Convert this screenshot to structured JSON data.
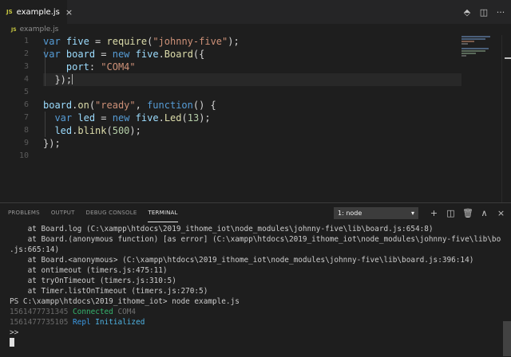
{
  "tab": {
    "icon": "JS",
    "filename": "example.js",
    "close": "×"
  },
  "breadcrumb": {
    "icon": "JS",
    "file": "example.js"
  },
  "editor_actions": [
    {
      "name": "open-changes-icon",
      "glyph": "⬘"
    },
    {
      "name": "split-editor-icon",
      "glyph": "◫"
    },
    {
      "name": "more-actions-icon",
      "glyph": "···"
    }
  ],
  "line_numbers": [
    "1",
    "2",
    "3",
    "4",
    "5",
    "6",
    "7",
    "8",
    "9",
    "10"
  ],
  "code_lines": [
    [
      {
        "c": "k",
        "t": "var"
      },
      {
        "c": "p",
        "t": " "
      },
      {
        "c": "v",
        "t": "five"
      },
      {
        "c": "p",
        "t": " = "
      },
      {
        "c": "f",
        "t": "require"
      },
      {
        "c": "p",
        "t": "("
      },
      {
        "c": "s",
        "t": "\"johnny-five\""
      },
      {
        "c": "p",
        "t": ");"
      }
    ],
    [
      {
        "c": "k",
        "t": "var"
      },
      {
        "c": "p",
        "t": " "
      },
      {
        "c": "v",
        "t": "board"
      },
      {
        "c": "p",
        "t": " = "
      },
      {
        "c": "k",
        "t": "new"
      },
      {
        "c": "p",
        "t": " "
      },
      {
        "c": "v",
        "t": "five"
      },
      {
        "c": "p",
        "t": "."
      },
      {
        "c": "f",
        "t": "Board"
      },
      {
        "c": "p",
        "t": "({"
      }
    ],
    [
      {
        "c": "p",
        "t": "    "
      },
      {
        "c": "v",
        "t": "port"
      },
      {
        "c": "p",
        "t": ": "
      },
      {
        "c": "s",
        "t": "\"COM4\""
      }
    ],
    [
      {
        "c": "p",
        "t": "  });"
      }
    ],
    [],
    [
      {
        "c": "v",
        "t": "board"
      },
      {
        "c": "p",
        "t": "."
      },
      {
        "c": "f",
        "t": "on"
      },
      {
        "c": "p",
        "t": "("
      },
      {
        "c": "s",
        "t": "\"ready\""
      },
      {
        "c": "p",
        "t": ", "
      },
      {
        "c": "k",
        "t": "function"
      },
      {
        "c": "p",
        "t": "() {"
      }
    ],
    [
      {
        "c": "p",
        "t": "  "
      },
      {
        "c": "k",
        "t": "var"
      },
      {
        "c": "p",
        "t": " "
      },
      {
        "c": "v",
        "t": "led"
      },
      {
        "c": "p",
        "t": " = "
      },
      {
        "c": "k",
        "t": "new"
      },
      {
        "c": "p",
        "t": " "
      },
      {
        "c": "v",
        "t": "five"
      },
      {
        "c": "p",
        "t": "."
      },
      {
        "c": "f",
        "t": "Led"
      },
      {
        "c": "p",
        "t": "("
      },
      {
        "c": "n",
        "t": "13"
      },
      {
        "c": "p",
        "t": ");"
      }
    ],
    [
      {
        "c": "p",
        "t": "  "
      },
      {
        "c": "v",
        "t": "led"
      },
      {
        "c": "p",
        "t": "."
      },
      {
        "c": "f",
        "t": "blink"
      },
      {
        "c": "p",
        "t": "("
      },
      {
        "c": "n",
        "t": "500"
      },
      {
        "c": "p",
        "t": ");"
      }
    ],
    [
      {
        "c": "p",
        "t": "});"
      }
    ],
    []
  ],
  "panel": {
    "tabs": [
      {
        "id": "problems",
        "label": "PROBLEMS",
        "active": false
      },
      {
        "id": "output",
        "label": "OUTPUT",
        "active": false
      },
      {
        "id": "debug-console",
        "label": "DEBUG CONSOLE",
        "active": false
      },
      {
        "id": "terminal",
        "label": "TERMINAL",
        "active": true
      }
    ],
    "terminal_select": "1: node",
    "terminal_select_caret": "▾",
    "actions": [
      {
        "name": "new-terminal-icon",
        "glyph": "+"
      },
      {
        "name": "split-terminal-icon",
        "glyph": "◫"
      },
      {
        "name": "kill-terminal-icon",
        "glyph": "🗑"
      },
      {
        "name": "maximize-panel-icon",
        "glyph": "∧"
      },
      {
        "name": "close-panel-icon",
        "glyph": "×"
      }
    ]
  },
  "terminal_lines": [
    [
      {
        "c": "",
        "t": "    at Board.log (C:\\xampp\\htdocs\\2019_ithome_iot\\node_modules\\johnny-five\\lib\\board.js:654:8)"
      }
    ],
    [
      {
        "c": "",
        "t": "    at Board.(anonymous function) [as error] (C:\\xampp\\htdocs\\2019_ithome_iot\\node_modules\\johnny-five\\lib\\board"
      }
    ],
    [
      {
        "c": "",
        "t": ".js:665:14)"
      }
    ],
    [
      {
        "c": "",
        "t": "    at Board.<anonymous> (C:\\xampp\\htdocs\\2019_ithome_iot\\node_modules\\johnny-five\\lib\\board.js:396:14)"
      }
    ],
    [
      {
        "c": "",
        "t": "    at ontimeout (timers.js:475:11)"
      }
    ],
    [
      {
        "c": "",
        "t": "    at tryOnTimeout (timers.js:310:5)"
      }
    ],
    [
      {
        "c": "",
        "t": "    at Timer.listOnTimeout (timers.js:270:5)"
      }
    ],
    [
      {
        "c": "",
        "t": "PS C:\\xampp\\htdocs\\2019_ithome_iot> node example.js"
      }
    ],
    [
      {
        "c": "dim",
        "t": "1561477731345 "
      },
      {
        "c": "cn",
        "t": "Connected "
      },
      {
        "c": "cm4",
        "t": "COM4"
      }
    ],
    [
      {
        "c": "dim",
        "t": "1561477735105 "
      },
      {
        "c": "repl",
        "t": "Repl "
      },
      {
        "c": "init",
        "t": "Initialized"
      }
    ],
    [
      {
        "c": "",
        "t": ">>"
      }
    ]
  ]
}
